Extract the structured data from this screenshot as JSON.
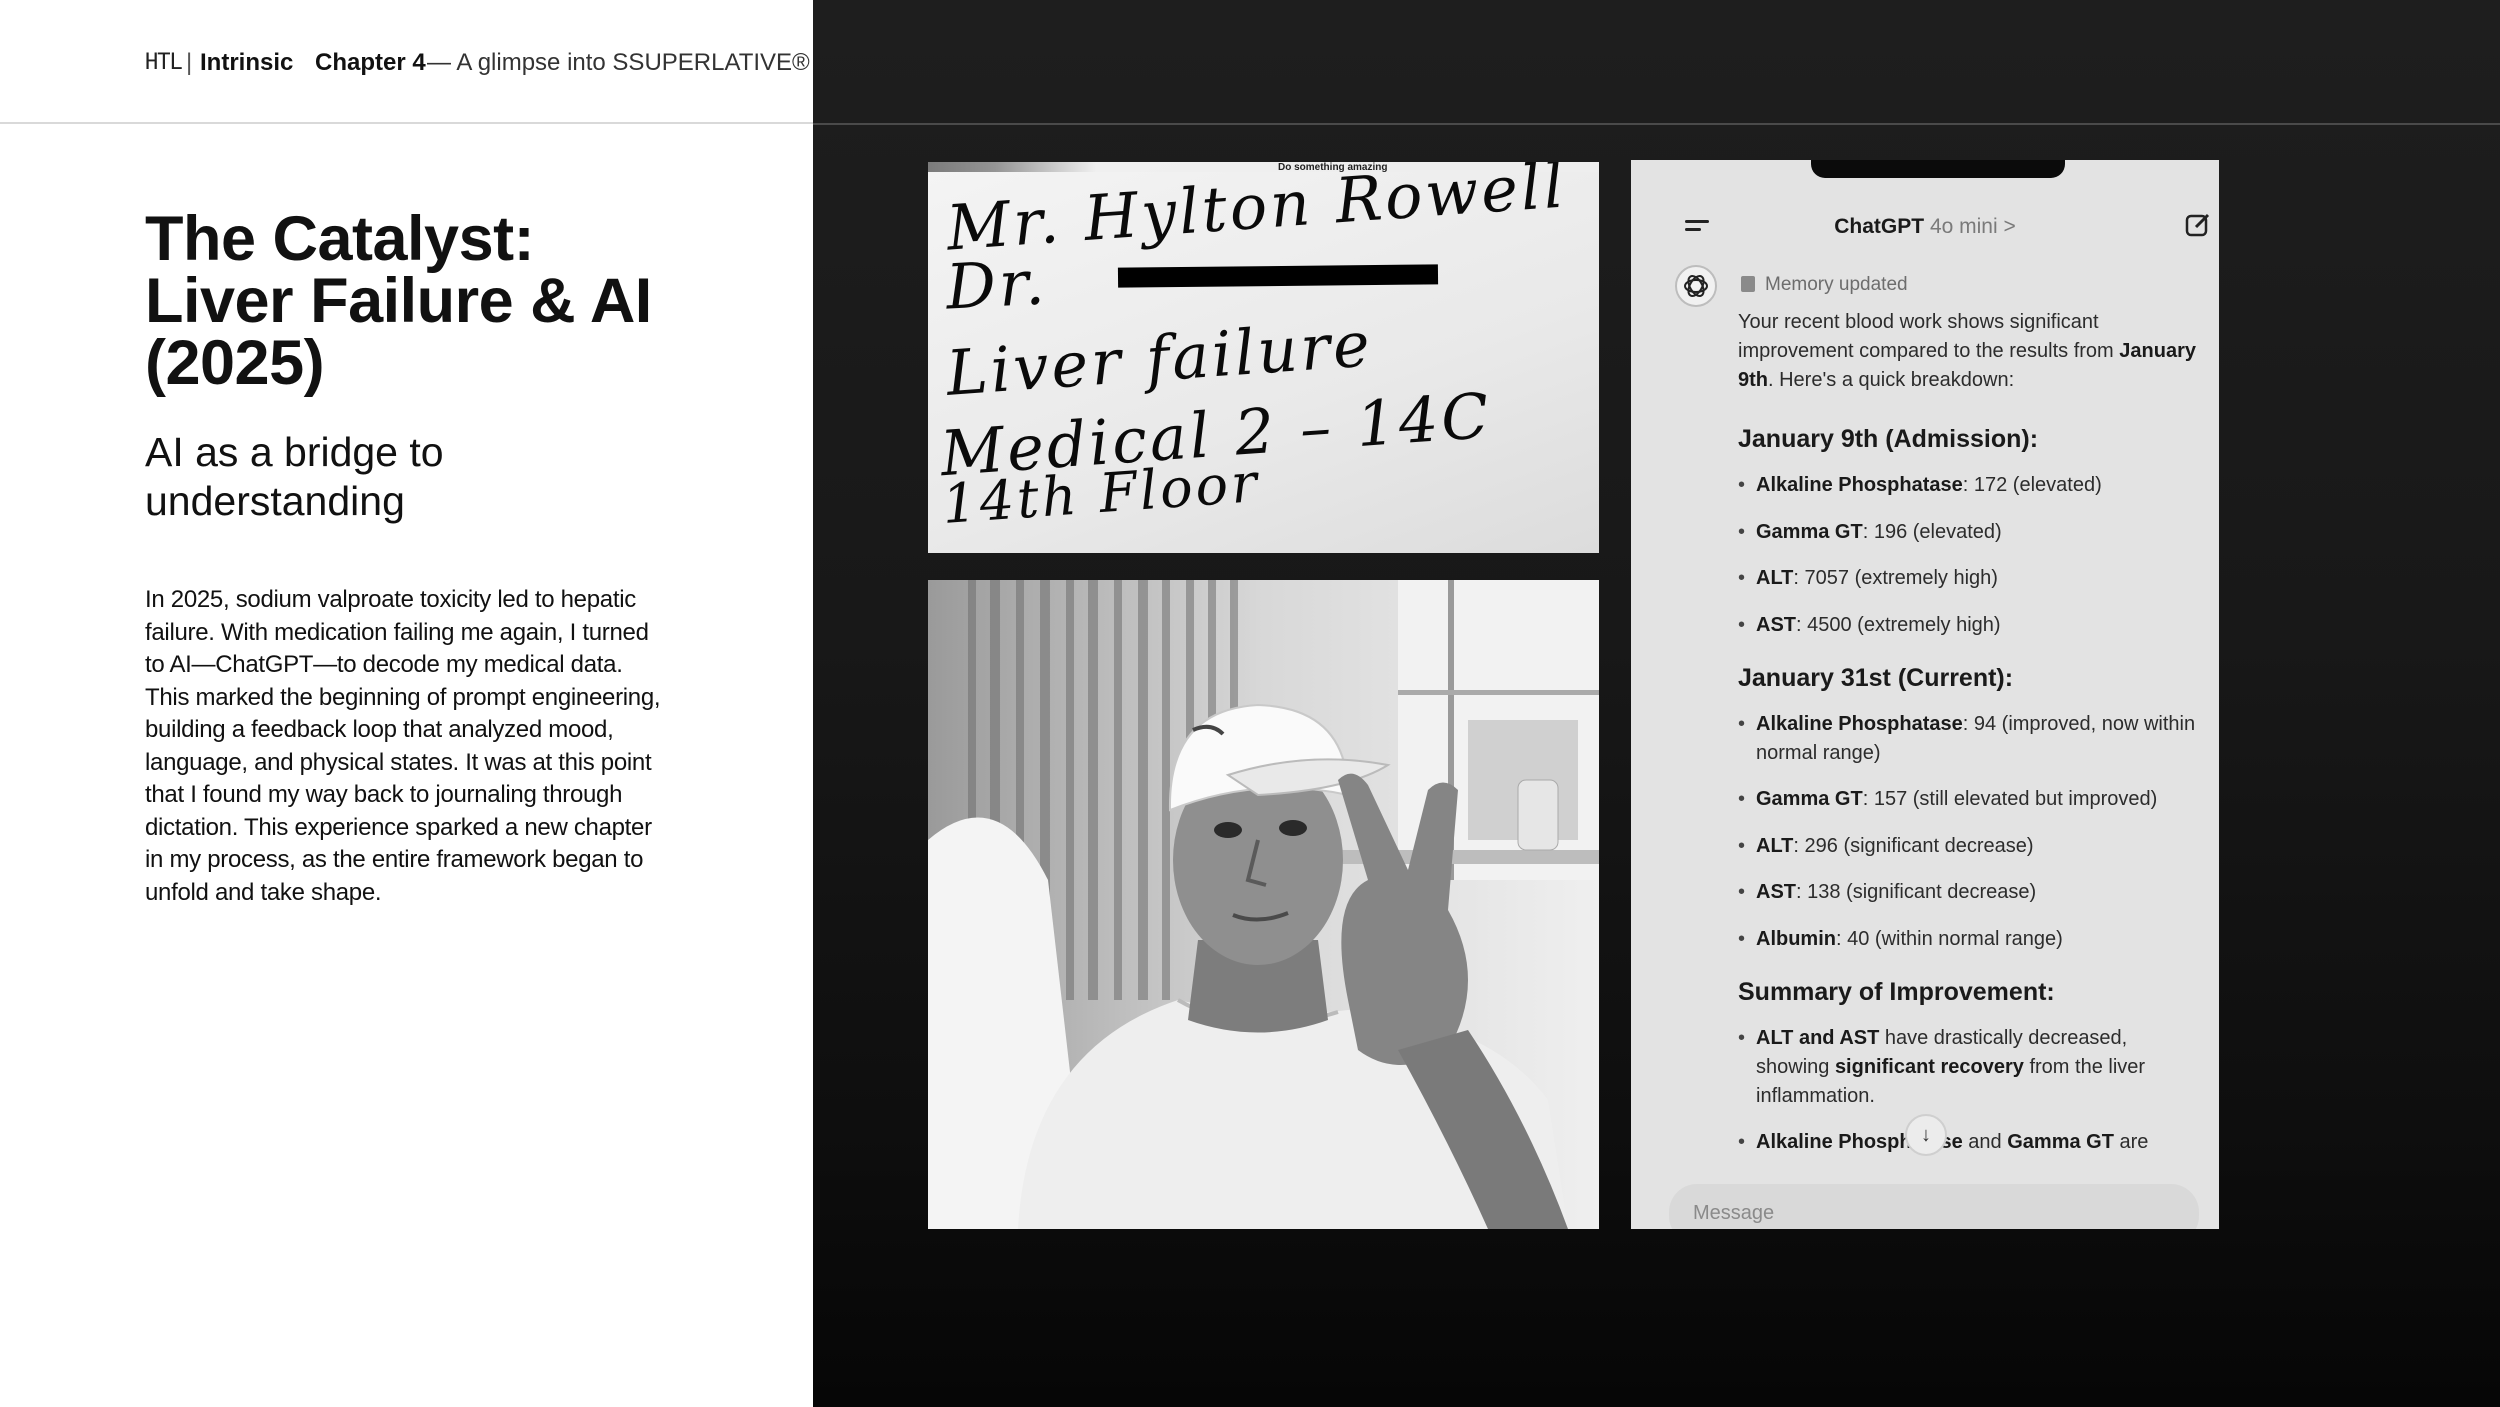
{
  "header": {
    "logo_mark": "HTL",
    "logo_separator": "|",
    "logo_name": "Intrinsic",
    "chapter": "Chapter 4",
    "subtitle": "— A glimpse into SSUPERLATIVE®"
  },
  "slide": {
    "title": "The Catalyst:\nLiver Failure & AI\n(2025)",
    "subtitle": "AI as a bridge to\nunderstanding",
    "body": "In 2025, sodium valproate toxicity led to hepatic failure. With medication failing me again, I turned to AI—ChatGPT—to decode my medical data. This marked the beginning of prompt engineering, building a feedback loop that analyzed mood, language, and physical states. It was at this point that I found my way back to journaling through dictation. This experience sparked a new chapter in my process, as the entire framework began to unfold and take shape."
  },
  "note": {
    "print_text": "Do something amazing",
    "line1": "Mr. Hylton Rowell",
    "line2": "Dr.",
    "line3": "Liver failure",
    "line4": "Medical 2 – 14C",
    "line5": "14th Floor"
  },
  "phone": {
    "app_name": "ChatGPT",
    "model": "4o mini",
    "chevron": ">",
    "memory_label": "Memory updated",
    "intro_pre": "Your recent blood work shows significant improvement compared to the results from ",
    "intro_bold": "January 9th",
    "intro_post": ". Here's a quick breakdown:",
    "section1_title": "January 9th (Admission):",
    "section1": [
      {
        "label": "Alkaline Phosphatase",
        "value": ": 172 (elevated)"
      },
      {
        "label": "Gamma GT",
        "value": ": 196 (elevated)"
      },
      {
        "label": "ALT",
        "value": ": 7057 (extremely high)"
      },
      {
        "label": "AST",
        "value": ": 4500 (extremely high)"
      }
    ],
    "section2_title": "January 31st (Current):",
    "section2": [
      {
        "label": "Alkaline Phosphatase",
        "value": ": 94 (improved, now within normal range)"
      },
      {
        "label": "Gamma GT",
        "value": ": 157 (still elevated but improved)"
      },
      {
        "label": "ALT",
        "value": ": 296 (significant decrease)"
      },
      {
        "label": "AST",
        "value": ": 138 (significant decrease)"
      },
      {
        "label": "Albumin",
        "value": ": 40 (within normal range)"
      }
    ],
    "section3_title": "Summary of Improvement:",
    "summary1_bold": "ALT and AST",
    "summary1_mid": " have drastically decreased, showing ",
    "summary1_bold2": "significant recovery",
    "summary1_post": " from the liver inflammation.",
    "summary2_bold": "Alkaline Phosphatase",
    "summary2_mid": " and ",
    "summary2_bold2": "Gamma GT",
    "summary2_post": " are",
    "scroll_glyph": "↓",
    "message_placeholder": "Message"
  }
}
